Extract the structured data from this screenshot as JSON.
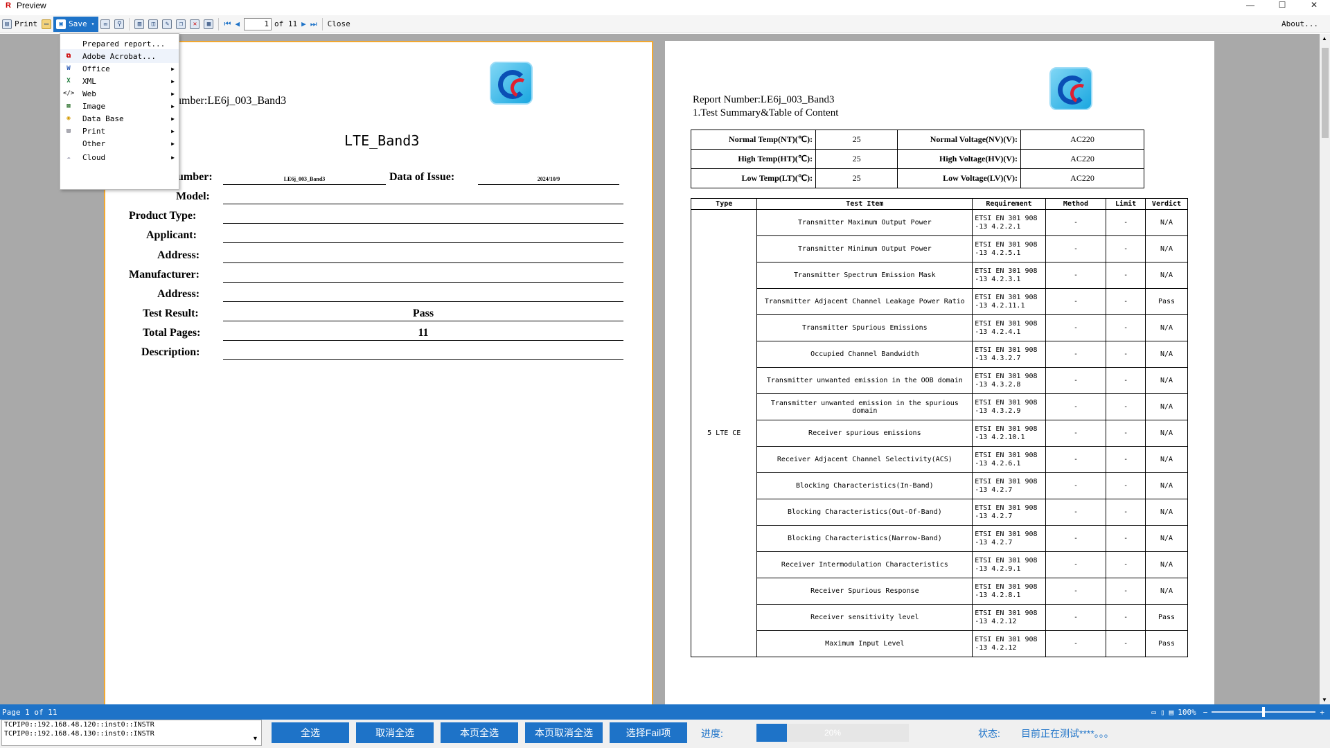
{
  "window": {
    "title": "Preview",
    "controls": [
      "—",
      "☐",
      "✕"
    ]
  },
  "toolbar": {
    "print_label": "Print",
    "save_label": "Save",
    "page_value": "1",
    "of_label": "of 11",
    "close_label": "Close",
    "about_label": "About..."
  },
  "save_menu": {
    "items": [
      {
        "label": "Prepared report...",
        "icon": "",
        "submenu": false
      },
      {
        "label": "Adobe Acrobat...",
        "icon": "pdf-icon",
        "submenu": false
      },
      {
        "label": "Office",
        "icon": "word-icon",
        "submenu": true
      },
      {
        "label": "XML",
        "icon": "excel-icon",
        "submenu": true
      },
      {
        "label": "Web",
        "icon": "html-icon",
        "submenu": true
      },
      {
        "label": "Image",
        "icon": "image-icon",
        "submenu": true
      },
      {
        "label": "Data Base",
        "icon": "database-icon",
        "submenu": true
      },
      {
        "label": "Print",
        "icon": "printer-icon",
        "submenu": true
      },
      {
        "label": "Other",
        "icon": "",
        "submenu": true
      },
      {
        "label": "Cloud",
        "icon": "cloud-icon",
        "submenu": true
      }
    ]
  },
  "page1": {
    "header": "umber:LE6j_003_Band3",
    "title": "LTE_Band3",
    "fields": {
      "report_number_label": "umber:",
      "report_number_value": "LE6j_003_Band3",
      "issue_label": "Data of Issue:",
      "issue_value": "2024/10/9",
      "model_label": "Model:",
      "product_type_label": "Product Type:",
      "applicant_label": "Applicant:",
      "address_label": "Address:",
      "manufacturer_label": "Manufacturer:",
      "address2_label": "Address:",
      "test_result_label": "Test Result:",
      "test_result_value": "Pass",
      "total_pages_label": "Total Pages:",
      "total_pages_value": "11",
      "description_label": "Description:"
    }
  },
  "page2": {
    "report_number": "Report Number:LE6j_003_Band3",
    "section_title": "1.Test Summary&Table of Content",
    "conditions": [
      {
        "l1": "Normal Temp(NT)(℃):",
        "v1": "25",
        "l2": "Normal Voltage(NV)(V):",
        "v2": "AC220"
      },
      {
        "l1": "High Temp(HT)(℃):",
        "v1": "25",
        "l2": "High Voltage(HV)(V):",
        "v2": "AC220"
      },
      {
        "l1": "Low Temp(LT)(℃):",
        "v1": "25",
        "l2": "Low Voltage(LV)(V):",
        "v2": "AC220"
      }
    ],
    "table_headers": [
      "Type",
      "Test Item",
      "Requirement",
      "Method",
      "Limit",
      "Verdict"
    ],
    "type_value": "5 LTE CE",
    "rows": [
      {
        "item": "Transmitter Maximum Output Power",
        "req": "ETSI EN 301 908 -13 4.2.2.1",
        "method": "-",
        "limit": "-",
        "verdict": "N/A"
      },
      {
        "item": "Transmitter Minimum Output Power",
        "req": "ETSI EN 301 908 -13 4.2.5.1",
        "method": "-",
        "limit": "-",
        "verdict": "N/A"
      },
      {
        "item": "Transmitter Spectrum Emission Mask",
        "req": "ETSI EN 301 908 -13 4.2.3.1",
        "method": "-",
        "limit": "-",
        "verdict": "N/A"
      },
      {
        "item": "Transmitter Adjacent Channel Leakage Power Ratio",
        "req": "ETSI EN 301 908 -13 4.2.11.1",
        "method": "-",
        "limit": "-",
        "verdict": "Pass"
      },
      {
        "item": "Transmitter Spurious Emissions",
        "req": "ETSI EN 301 908 -13 4.2.4.1",
        "method": "-",
        "limit": "-",
        "verdict": "N/A"
      },
      {
        "item": "Occupied Channel Bandwidth",
        "req": "ETSI EN 301 908 -13 4.3.2.7",
        "method": "-",
        "limit": "-",
        "verdict": "N/A"
      },
      {
        "item": "Transmitter unwanted emission in the OOB domain",
        "req": "ETSI EN 301 908 -13 4.3.2.8",
        "method": "-",
        "limit": "-",
        "verdict": "N/A"
      },
      {
        "item": "Transmitter unwanted emission in the spurious domain",
        "req": "ETSI EN 301 908 -13 4.3.2.9",
        "method": "-",
        "limit": "-",
        "verdict": "N/A"
      },
      {
        "item": "Receiver spurious emissions",
        "req": "ETSI EN 301 908 -13 4.2.10.1",
        "method": "-",
        "limit": "-",
        "verdict": "N/A"
      },
      {
        "item": "Receiver Adjacent Channel Selectivity(ACS)",
        "req": "ETSI EN 301 908 -13 4.2.6.1",
        "method": "-",
        "limit": "-",
        "verdict": "N/A"
      },
      {
        "item": "Blocking Characteristics(In-Band)",
        "req": "ETSI EN 301 908 -13 4.2.7",
        "method": "-",
        "limit": "-",
        "verdict": "N/A"
      },
      {
        "item": "Blocking Characteristics(Out-Of-Band)",
        "req": "ETSI EN 301 908 -13 4.2.7",
        "method": "-",
        "limit": "-",
        "verdict": "N/A"
      },
      {
        "item": "Blocking Characteristics(Narrow-Band)",
        "req": "ETSI EN 301 908 -13 4.2.7",
        "method": "-",
        "limit": "-",
        "verdict": "N/A"
      },
      {
        "item": "Receiver Intermodulation Characteristics",
        "req": "ETSI EN 301 908 -13 4.2.9.1",
        "method": "-",
        "limit": "-",
        "verdict": "N/A"
      },
      {
        "item": "Receiver Spurious Response",
        "req": "ETSI EN 301 908 -13 4.2.8.1",
        "method": "-",
        "limit": "-",
        "verdict": "N/A"
      },
      {
        "item": "Receiver sensitivity level",
        "req": "ETSI EN 301 908 -13 4.2.12",
        "method": "-",
        "limit": "-",
        "verdict": "Pass"
      },
      {
        "item": "Maximum Input Level",
        "req": "ETSI EN 301 908 -13 4.2.12",
        "method": "-",
        "limit": "-",
        "verdict": "Pass"
      }
    ]
  },
  "statusbar": {
    "page_text": "Page 1 of 11",
    "zoom": "100%"
  },
  "bottom": {
    "log_lines": [
      "TCPIP0::192.168.48.120::inst0::INSTR",
      "TCPIP0::192.168.48.130::inst0::INSTR"
    ],
    "buttons": [
      "全选",
      "取消全选",
      "本页全选",
      "本页取消全选",
      "选择Fail项"
    ],
    "progress_label": "进度:",
    "progress_value": "20%",
    "progress_fraction": 0.2,
    "status_label": "状态:",
    "status_value": "目前正在测试****。。。"
  },
  "colors": {
    "accent": "#1e73c8",
    "workspace": "#a9a9a9",
    "page_highlight": "#f2a830"
  }
}
